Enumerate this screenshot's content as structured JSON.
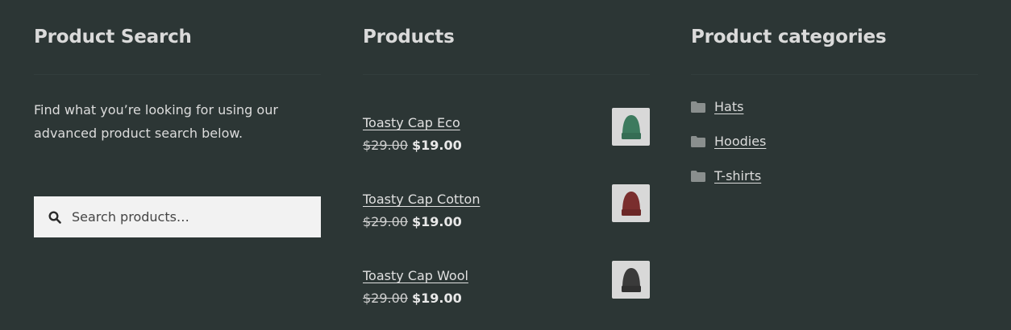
{
  "search_widget": {
    "title": "Product Search",
    "description": "Find what you’re looking for using our advanced product search below.",
    "placeholder": "Search products…"
  },
  "products_widget": {
    "title": "Products",
    "items": [
      {
        "name": "Toasty Cap Eco",
        "old_price": "$29.00",
        "new_price": "$19.00",
        "color": "#3c7a5e"
      },
      {
        "name": "Toasty Cap Cotton",
        "old_price": "$29.00",
        "new_price": "$19.00",
        "color": "#7a2e2e"
      },
      {
        "name": "Toasty Cap Wool",
        "old_price": "$29.00",
        "new_price": "$19.00",
        "color": "#3a3a3a"
      }
    ]
  },
  "categories_widget": {
    "title": "Product categories",
    "items": [
      {
        "label": "Hats"
      },
      {
        "label": "Hoodies"
      },
      {
        "label": "T-shirts"
      }
    ]
  },
  "icons": {
    "search": "search-icon",
    "folder": "folder-icon"
  },
  "colors": {
    "background": "#2c3635",
    "search_box": "#f2f2f2",
    "text": "#e3e3e3"
  }
}
